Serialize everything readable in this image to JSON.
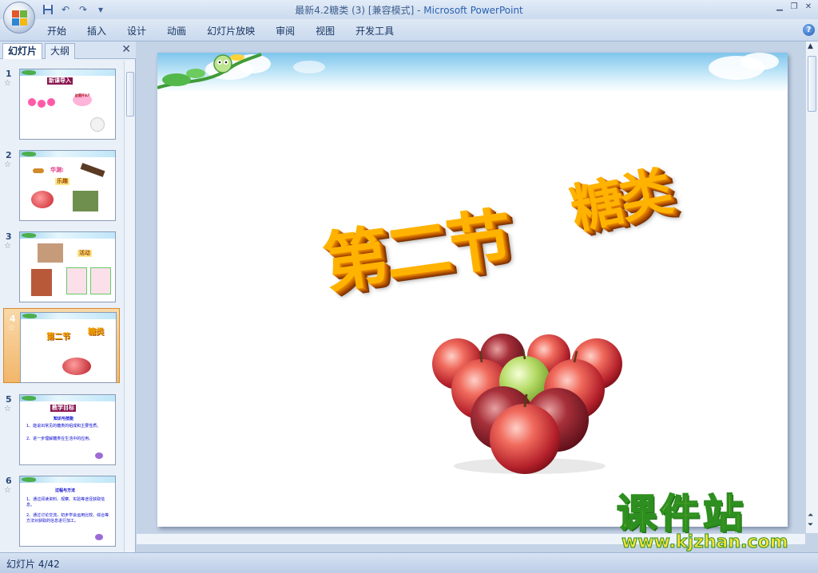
{
  "window": {
    "title_doc": "最新4.2糖类 (3) [兼容模式] - ",
    "title_app": "Microsoft PowerPoint"
  },
  "ribbon": {
    "tabs": [
      "开始",
      "插入",
      "设计",
      "动画",
      "幻灯片放映",
      "审阅",
      "视图",
      "开发工具"
    ],
    "help": "?"
  },
  "pane": {
    "tabs": [
      "幻灯片",
      "大纲"
    ],
    "close": "✕"
  },
  "slides": [
    {
      "num": "1",
      "title": "新课导入",
      "bubble": "这是什么?"
    },
    {
      "num": "2",
      "title": "华测:",
      "subtitle": "乐趣"
    },
    {
      "num": "3",
      "title": "活动"
    },
    {
      "num": "4",
      "title_a": "第二节",
      "title_b": "糖类"
    },
    {
      "num": "5",
      "title": "教学目标",
      "subtitle": "知识与技能",
      "lines": [
        "1、能说出常见的糖类的组成和主要性质。",
        "2、进一步理解糖类在生活中的应用。"
      ]
    },
    {
      "num": "6",
      "title": "过程与方法",
      "lines": [
        "1、通过阅读资料、观察、实验等途径获取信息。",
        "2、通过讨论交流，初步学会运用比较、综合等方法对获取的信息进行加工。"
      ]
    }
  ],
  "current_slide": {
    "text_a": "第二节",
    "text_b": "糖类"
  },
  "watermark": {
    "main": "课件站",
    "url": "www.kjzhan.com"
  },
  "status": {
    "slide_counter": "幻灯片 4/42"
  },
  "colors": {
    "wordart": "#ffb300",
    "watermark_fill": "#f3e23a",
    "watermark_stroke": "#2d8f1f"
  }
}
